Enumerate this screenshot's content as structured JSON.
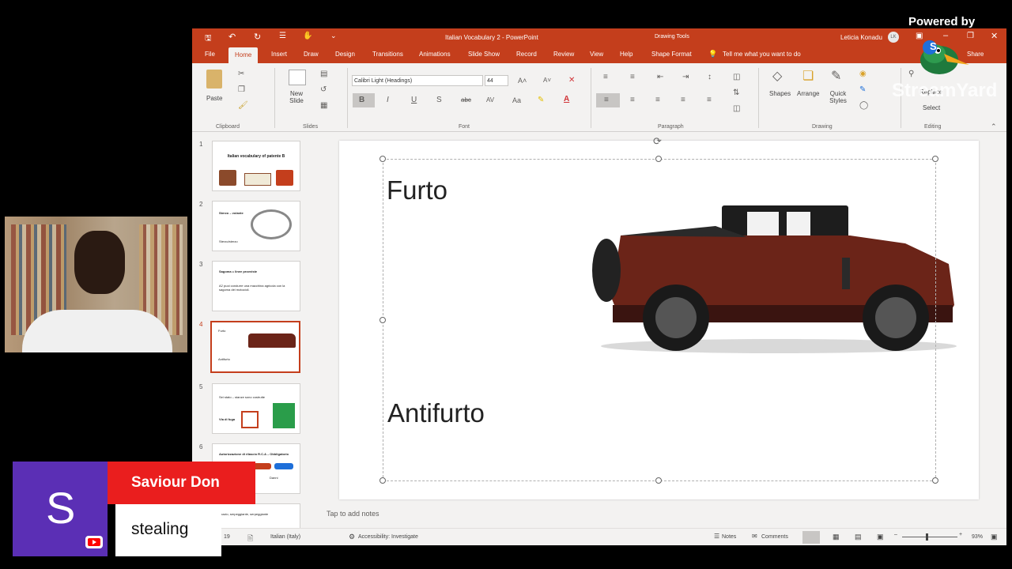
{
  "window": {
    "document_title": "Italian Vocabulary 2 - PowerPoint",
    "context_tab_group": "Drawing Tools",
    "user_name": "Leticia Konadu",
    "user_initials": "LK"
  },
  "tabs": [
    "File",
    "Home",
    "Insert",
    "Draw",
    "Design",
    "Transitions",
    "Animations",
    "Slide Show",
    "Record",
    "Review",
    "View",
    "Help",
    "Shape Format"
  ],
  "active_tab": "Home",
  "tell_me": "Tell me what you want to do",
  "share_label": "Share",
  "ribbon": {
    "clipboard": {
      "paste": "Paste",
      "label": "Clipboard"
    },
    "slides": {
      "new_slide": "New Slide",
      "label": "Slides"
    },
    "font": {
      "name": "Calibri Light (Headings)",
      "size": "44",
      "label": "Font"
    },
    "paragraph": {
      "label": "Paragraph"
    },
    "drawing": {
      "shapes": "Shapes",
      "arrange": "Arrange",
      "quick_styles": "Quick Styles",
      "label": "Drawing"
    },
    "editing": {
      "replace": "Replace",
      "select": "Select",
      "label": "Editing"
    }
  },
  "thumbnails": [
    {
      "num": "1",
      "title": "Italian vocabulary of patente B"
    },
    {
      "num": "2",
      "title": "Sterzo – volante",
      "caption": "Sterzo/sterzo"
    },
    {
      "num": "3",
      "title": "Sagoma = linee provviste",
      "caption": "A2 puoi condurre una macchina agricola con la sagoma dei motocicli."
    },
    {
      "num": "4",
      "title": "Furto",
      "caption": "Antifurto"
    },
    {
      "num": "5",
      "title": "Sei stato – stanze sono costrutte",
      "caption": "Via di fuga"
    },
    {
      "num": "6",
      "title": "Autorizzazione di rilascio R.C.A – Obbligatorio",
      "caption": "Danni"
    },
    {
      "num": "7",
      "title": "spazio, serpeggiante, serpeggiante"
    }
  ],
  "slide": {
    "title": "Furto",
    "subtitle": "Antifurto"
  },
  "notes_placeholder": "Tap to add notes",
  "status": {
    "slide_counter": "19",
    "language": "Italian (Italy)",
    "accessibility": "Accessibility: Investigate",
    "notes": "Notes",
    "comments": "Comments",
    "zoom": "93%"
  },
  "overlay": {
    "powered_by": "Powered by",
    "brand": "StreamYard",
    "avatar_letter": "S",
    "presenter_name": "Saviour Don",
    "message": "stealing"
  },
  "colors": {
    "ppt_accent": "#c43e1c",
    "avatar_bg": "#5b2fb5",
    "name_bar": "#ea1e1e",
    "car_body": "#6b2418"
  }
}
